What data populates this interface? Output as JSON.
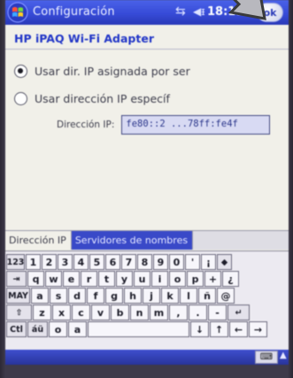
{
  "titlebar": {
    "app_title": "Configuración",
    "clock": "18:13",
    "ok_label": "ok",
    "net_icon": "network-icon",
    "vol_icon": "volume-icon"
  },
  "page": {
    "adapter_title": "HP iPAQ Wi-Fi Adapter",
    "radio_auto_label": "Usar dir. IP asignada por ser",
    "radio_auto_checked": true,
    "radio_manual_label": "Usar dirección IP específ",
    "radio_manual_checked": false,
    "ip_label": "Dirección IP:",
    "ip_value": "fe80::2 ...78ff:fe4f"
  },
  "tabs": [
    {
      "label": "Dirección IP",
      "active": true
    },
    {
      "label": "Servidores de nombres",
      "active": false
    }
  ],
  "keyboard": {
    "rows": [
      [
        "123",
        "1",
        "2",
        "3",
        "4",
        "5",
        "6",
        "7",
        "8",
        "9",
        "0",
        "'",
        "¡",
        "◆"
      ],
      [
        "⇥",
        "q",
        "w",
        "e",
        "r",
        "t",
        "y",
        "u",
        "i",
        "o",
        "p",
        "+",
        "¿"
      ],
      [
        "MAY",
        "a",
        "s",
        "d",
        "f",
        "g",
        "h",
        "j",
        "k",
        "l",
        "ñ",
        "@"
      ],
      [
        "⇧",
        "z",
        "x",
        "c",
        "v",
        "b",
        "n",
        "m",
        ",",
        ".",
        "-",
        "↵"
      ],
      [
        "Ctl",
        "áü",
        "o",
        "a",
        "",
        "↓",
        "↑",
        "←",
        "→"
      ]
    ]
  },
  "colors": {
    "titlebar": "#3a4cc6",
    "accent": "#2537b5",
    "arrow_fill": "#b8b8be",
    "arrow_stroke": "#3a3a3a"
  },
  "icons": {
    "start": "windows-flag-icon",
    "sip": "keyboard-icon",
    "pointer": "arrow-pointer-icon"
  }
}
